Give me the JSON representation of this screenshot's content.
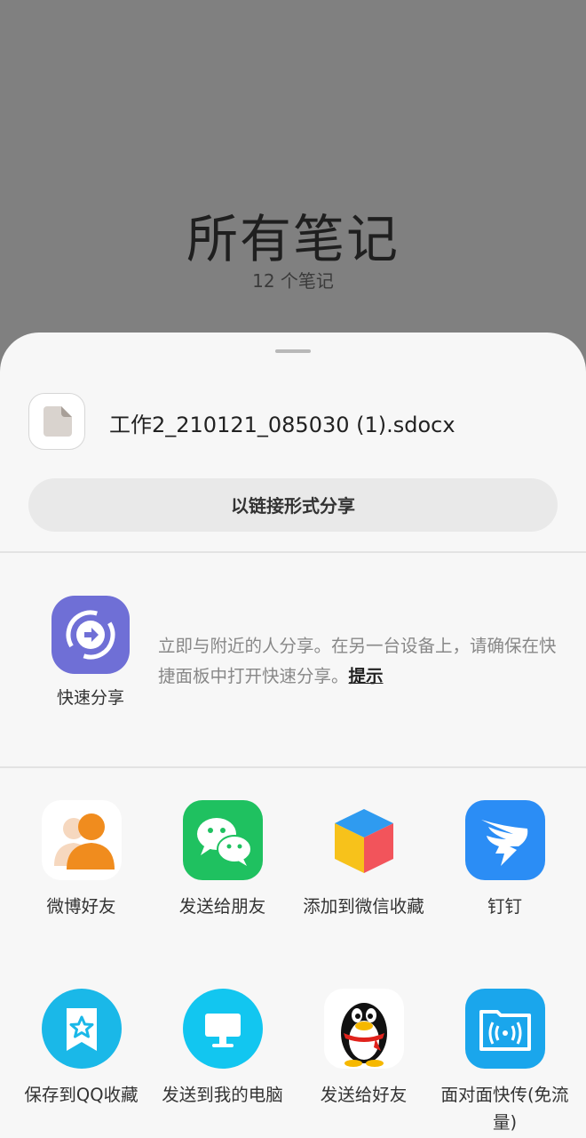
{
  "background": {
    "title": "所有笔记",
    "subtitle": "12 个笔记"
  },
  "share": {
    "file_name": "工作2_210121_085030 (1).sdocx",
    "link_share_label": "以链接形式分享",
    "quick_share": {
      "label": "快速分享",
      "description": "立即与附近的人分享。在另一台设备上，请确保在快捷面板中打开快速分享。",
      "hint": "提示"
    },
    "apps": [
      {
        "label": "微博好友",
        "icon": "weibo-friend-icon"
      },
      {
        "label": "发送给朋友",
        "icon": "wechat-icon"
      },
      {
        "label": "添加到微信收藏",
        "icon": "wechat-favorites-cube-icon"
      },
      {
        "label": "钉钉",
        "icon": "dingtalk-icon"
      },
      {
        "label": "保存到QQ收藏",
        "icon": "qq-favorites-icon"
      },
      {
        "label": "发送到我的电脑",
        "icon": "my-computer-icon"
      },
      {
        "label": "发送给好友",
        "icon": "qq-penguin-icon"
      },
      {
        "label": "面对面快传(免流量)",
        "icon": "face-to-face-transfer-icon"
      }
    ]
  },
  "colors": {
    "sheet_background": "#f7f7f7",
    "quick_share_accent": "#6f6fd6",
    "wechat_green": "#1fc160",
    "dingtalk_blue": "#2b8df5",
    "qq_cyan": "#1ab8e8",
    "weibo_orange": "#f08c1e"
  }
}
